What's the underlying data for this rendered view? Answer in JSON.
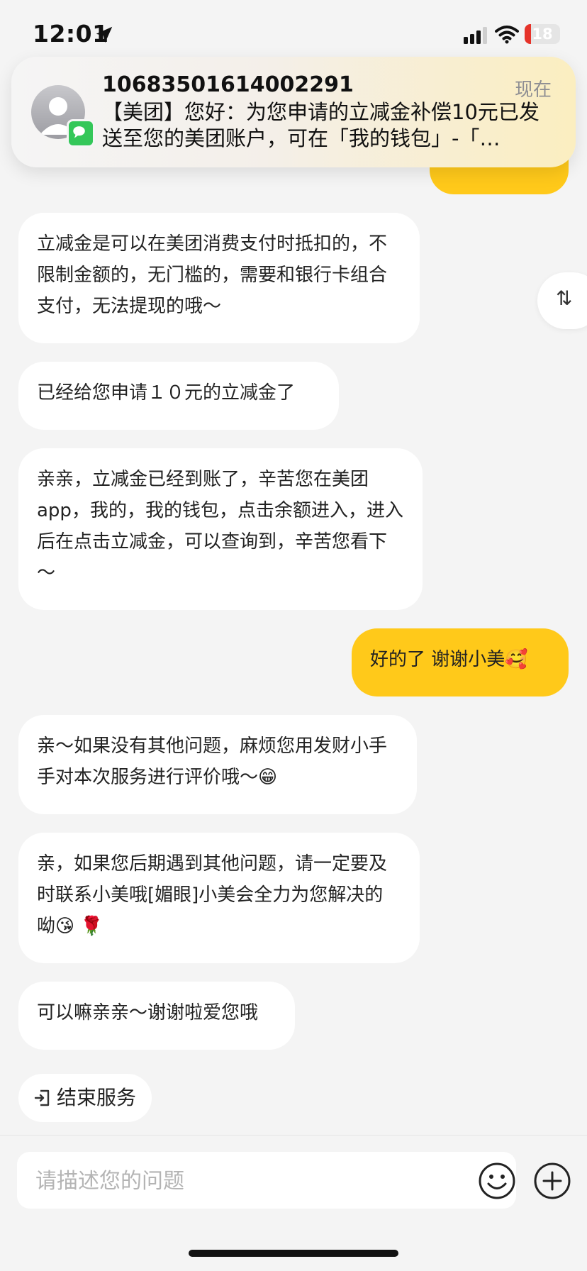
{
  "status_bar": {
    "time": "12:01",
    "battery_level": "18",
    "battery_fraction": 0.18,
    "battery_color": "#e6332a",
    "icons": [
      "location-arrow-icon",
      "cellular-signal-icon",
      "wifi-icon",
      "battery-icon"
    ]
  },
  "notification": {
    "sender": "10683501614002291",
    "time": "现在",
    "body": "【美团】您好：为您申请的立减金补偿10元已发送至您的美团账户，可在「我的钱包」-「…",
    "icons": [
      "contact-avatar-icon",
      "messages-app-icon"
    ]
  },
  "messages": [
    {
      "role": "agent",
      "text": "立减金是可以在美团消费支付时抵扣的，不限制金额的，无门槛的，需要和银行卡组合支付，无法提现的哦～"
    },
    {
      "role": "agent",
      "text": "已经给您申请１０元的立减金了"
    },
    {
      "role": "agent",
      "text": "亲亲，立减金已经到账了，辛苦您在美团app，我的，我的钱包，点击余额进入，进入后在点击立减金，可以查询到，辛苦您看下～"
    },
    {
      "role": "user",
      "text": "好的了 谢谢小美🥰"
    },
    {
      "role": "agent",
      "text": "亲～如果没有其他问题，麻烦您用发财小手手对本次服务进行评价哦～😁"
    },
    {
      "role": "agent",
      "text": "亲，如果您后期遇到其他问题，请一定要及时联系小美哦[媚眼]小美会全力为您解决的呦😘 🌹"
    },
    {
      "role": "agent",
      "text": "可以嘛亲亲～谢谢啦爱您哦"
    }
  ],
  "scroll_toggle": {
    "glyph": "⇅"
  },
  "actions": {
    "end_service": "结束服务"
  },
  "input": {
    "placeholder": "请描述您的问题",
    "value": ""
  },
  "colors": {
    "user_bubble": "#ffc91a",
    "agent_bubble": "#ffffff",
    "background": "#f4f4f4"
  }
}
